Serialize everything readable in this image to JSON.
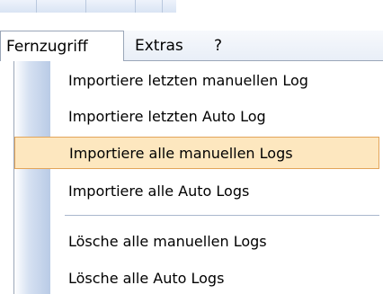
{
  "menubar": {
    "items": [
      {
        "label": "Fernzugriff"
      },
      {
        "label": "Extras"
      },
      {
        "label": "?"
      }
    ]
  },
  "menu": {
    "items": [
      {
        "label": "Importiere letzten manuellen Log"
      },
      {
        "label": "Importiere letzten Auto Log"
      },
      {
        "label": "Importiere alle manuellen Logs"
      },
      {
        "label": "Importiere alle Auto Logs"
      },
      {
        "label": "Lösche alle manuellen Logs"
      },
      {
        "label": "Lösche alle Auto Logs"
      }
    ]
  },
  "colors": {
    "hover_bg": "#fde7bf",
    "hover_border": "#e2a55a",
    "gutter": "#b9cbe6"
  }
}
